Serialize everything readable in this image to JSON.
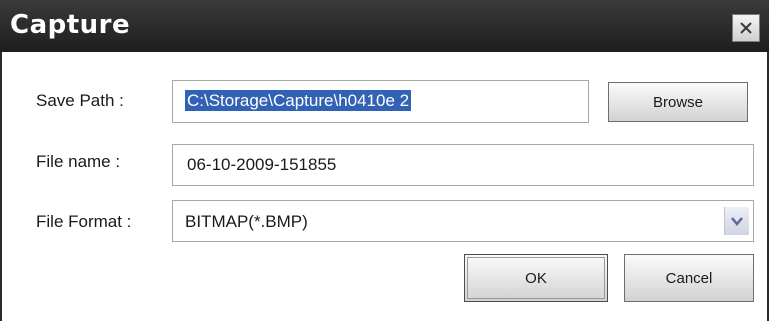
{
  "window": {
    "title": "Capture",
    "close_icon": "close-icon"
  },
  "form": {
    "save_path": {
      "label": "Save Path :",
      "value": "C:\\Storage\\Capture\\h0410e 2",
      "browse_label": "Browse"
    },
    "file_name": {
      "label": "File name :",
      "value": "06-10-2009-151855"
    },
    "file_format": {
      "label": "File Format :",
      "selected": "BITMAP(*.BMP)",
      "arrow_icon": "chevron-down-icon"
    }
  },
  "buttons": {
    "ok_label": "OK",
    "cancel_label": "Cancel"
  },
  "colors": {
    "titlebar": "#2b2b2b",
    "selection": "#3162b6"
  }
}
